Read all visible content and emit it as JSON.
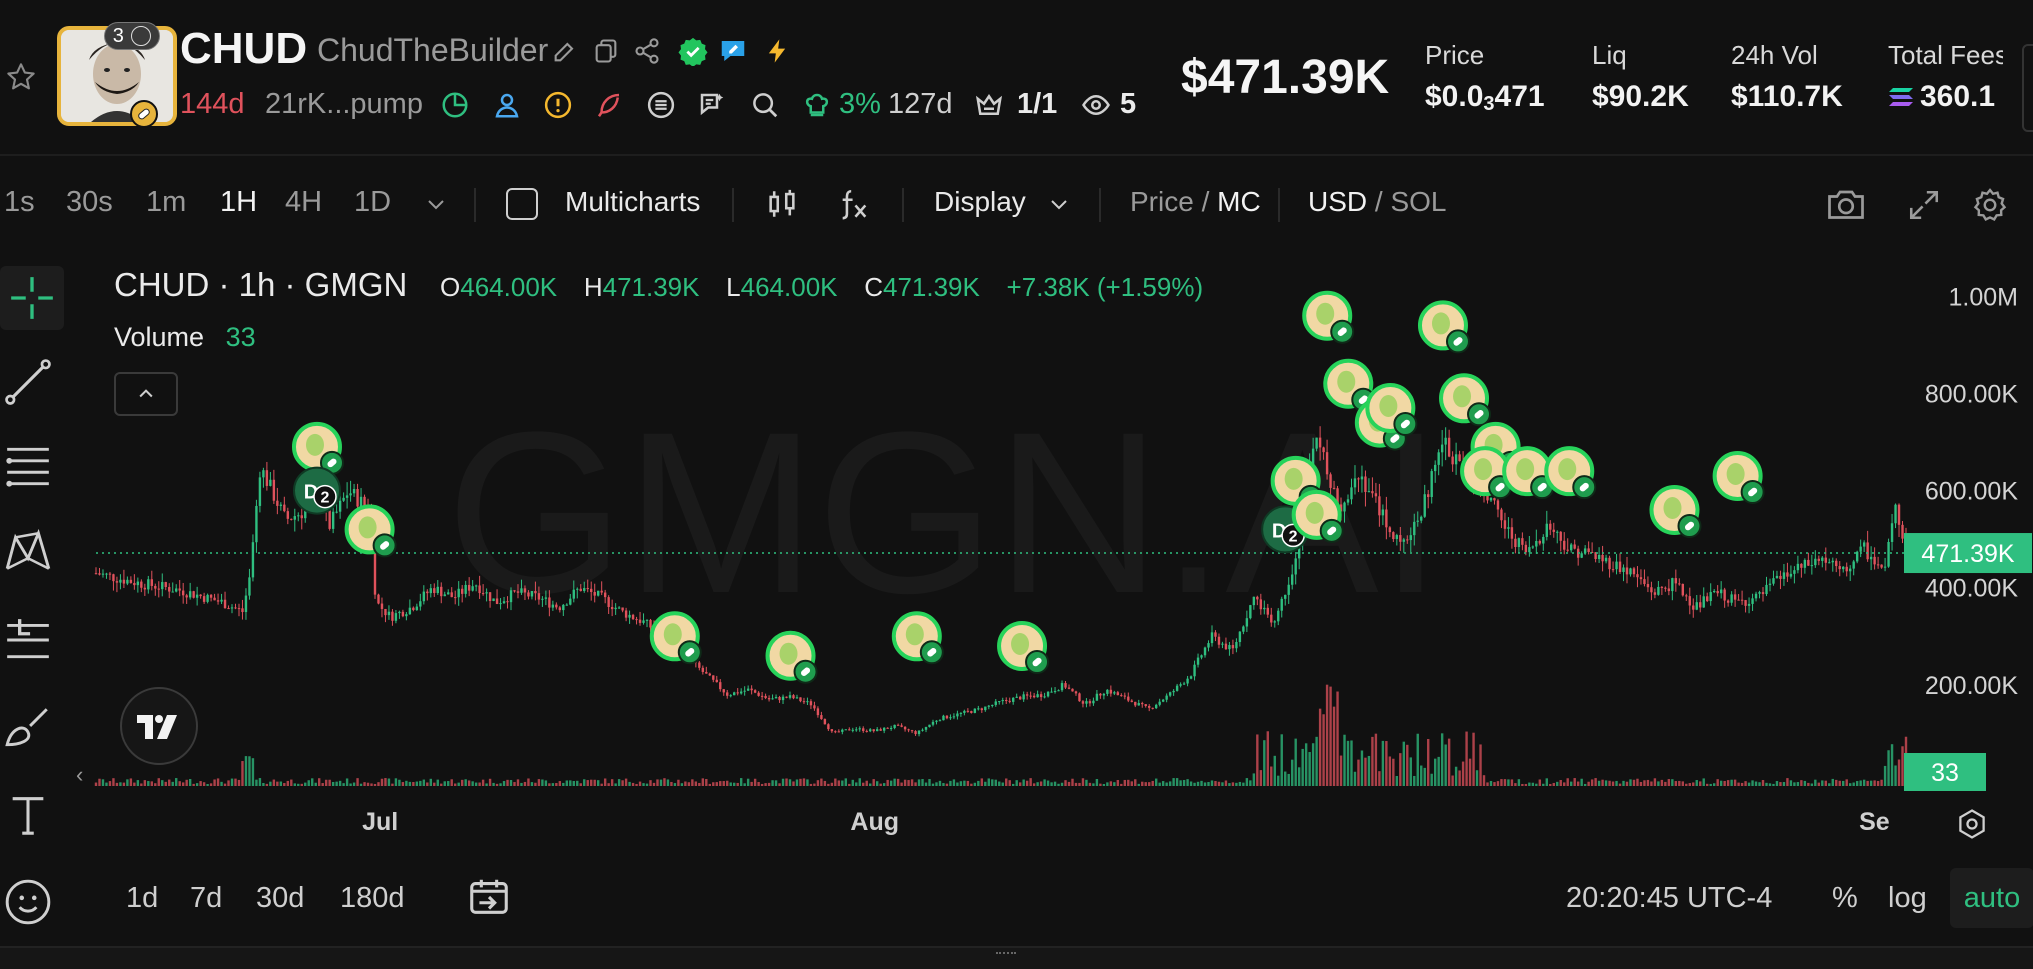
{
  "token": {
    "symbol": "CHUD",
    "creator": "ChudTheBuilder",
    "avatar_badge_count": "3",
    "age": "144d",
    "contract": "21rK...pump",
    "holder_pct": "3%",
    "holder_age": "127d",
    "top_ratio": "1/1",
    "watchers": "5"
  },
  "market_cap": "$471.39K",
  "stats": [
    {
      "label": "Price",
      "value_main": "$0.0",
      "value_sub": "3",
      "value_tail": "471"
    },
    {
      "label": "Liq",
      "value": "$90.2K"
    },
    {
      "label": "24h Vol",
      "value": "$110.7K"
    },
    {
      "label": "Total Fees",
      "value": "360.1"
    }
  ],
  "toolbar": {
    "timeframes": [
      "1s",
      "30s",
      "1m",
      "1H",
      "4H",
      "1D"
    ],
    "active_timeframe": "1H",
    "multicharts": "Multicharts",
    "display": "Display",
    "price_label": "Price",
    "mc_label": "MC",
    "usd_label": "USD",
    "sol_label": "SOL"
  },
  "legend": {
    "title": "CHUD · 1h · GMGN",
    "o_label": "O",
    "o_val": "464.00K",
    "h_label": "H",
    "h_val": "471.39K",
    "l_label": "L",
    "l_val": "464.00K",
    "c_label": "C",
    "c_val": "471.39K",
    "change": "+7.38K (+1.59%)",
    "volume_label": "Volume",
    "volume_val": "33"
  },
  "watermark": "GMGN.AI",
  "chart_data": {
    "type": "line",
    "title": "CHUD · 1h · GMGN",
    "x_ticks": [
      "Jul",
      "Aug",
      "Se"
    ],
    "y_ticks": [
      "1.00M",
      "800.00K",
      "600.00K",
      "400.00K",
      "200.00K"
    ],
    "ylim": [
      0,
      1050000
    ],
    "current_price_label": "471.39K",
    "current_price": 471390,
    "volume_label": "33",
    "price_series": [
      {
        "t": 0,
        "v": 430000
      },
      {
        "t": 2,
        "v": 410000
      },
      {
        "t": 4,
        "v": 395000
      },
      {
        "t": 6,
        "v": 370000
      },
      {
        "t": 7,
        "v": 350000
      },
      {
        "t": 7.3,
        "v": 420000
      },
      {
        "t": 7.8,
        "v": 650000
      },
      {
        "t": 9,
        "v": 540000
      },
      {
        "t": 10,
        "v": 560000
      },
      {
        "t": 10.5,
        "v": 720000
      },
      {
        "t": 11,
        "v": 520000
      },
      {
        "t": 12,
        "v": 600000
      },
      {
        "t": 13,
        "v": 560000
      },
      {
        "t": 13.3,
        "v": 370000
      },
      {
        "t": 14,
        "v": 340000
      },
      {
        "t": 15,
        "v": 360000
      },
      {
        "t": 16,
        "v": 400000
      },
      {
        "t": 17,
        "v": 380000
      },
      {
        "t": 18,
        "v": 410000
      },
      {
        "t": 19,
        "v": 370000
      },
      {
        "t": 20,
        "v": 390000
      },
      {
        "t": 21,
        "v": 380000
      },
      {
        "t": 22,
        "v": 360000
      },
      {
        "t": 23,
        "v": 400000
      },
      {
        "t": 24,
        "v": 380000
      },
      {
        "t": 25,
        "v": 350000
      },
      {
        "t": 26,
        "v": 330000
      },
      {
        "t": 27,
        "v": 300000
      },
      {
        "t": 28,
        "v": 260000
      },
      {
        "t": 29,
        "v": 220000
      },
      {
        "t": 30,
        "v": 180000
      },
      {
        "t": 31,
        "v": 190000
      },
      {
        "t": 32,
        "v": 170000
      },
      {
        "t": 33,
        "v": 175000
      },
      {
        "t": 34,
        "v": 160000
      },
      {
        "t": 35,
        "v": 100000
      },
      {
        "t": 36,
        "v": 110000
      },
      {
        "t": 37,
        "v": 105000
      },
      {
        "t": 38,
        "v": 115000
      },
      {
        "t": 39,
        "v": 100000
      },
      {
        "t": 40,
        "v": 130000
      },
      {
        "t": 41,
        "v": 140000
      },
      {
        "t": 42,
        "v": 150000
      },
      {
        "t": 43,
        "v": 165000
      },
      {
        "t": 44,
        "v": 175000
      },
      {
        "t": 45,
        "v": 180000
      },
      {
        "t": 46,
        "v": 200000
      },
      {
        "t": 47,
        "v": 160000
      },
      {
        "t": 48,
        "v": 190000
      },
      {
        "t": 49,
        "v": 170000
      },
      {
        "t": 50,
        "v": 150000
      },
      {
        "t": 51,
        "v": 180000
      },
      {
        "t": 52,
        "v": 220000
      },
      {
        "t": 53,
        "v": 300000
      },
      {
        "t": 54,
        "v": 270000
      },
      {
        "t": 55,
        "v": 380000
      },
      {
        "t": 56,
        "v": 330000
      },
      {
        "t": 57,
        "v": 460000
      },
      {
        "t": 58,
        "v": 720000
      },
      {
        "t": 59,
        "v": 560000
      },
      {
        "t": 60,
        "v": 640000
      },
      {
        "t": 61,
        "v": 560000
      },
      {
        "t": 62,
        "v": 480000
      },
      {
        "t": 63,
        "v": 560000
      },
      {
        "t": 64,
        "v": 700000
      },
      {
        "t": 65,
        "v": 640000
      },
      {
        "t": 66,
        "v": 600000
      },
      {
        "t": 67,
        "v": 520000
      },
      {
        "t": 68,
        "v": 470000
      },
      {
        "t": 69,
        "v": 530000
      },
      {
        "t": 70,
        "v": 480000
      },
      {
        "t": 71,
        "v": 470000
      },
      {
        "t": 72,
        "v": 450000
      },
      {
        "t": 73,
        "v": 430000
      },
      {
        "t": 74,
        "v": 390000
      },
      {
        "t": 75,
        "v": 410000
      },
      {
        "t": 76,
        "v": 360000
      },
      {
        "t": 77,
        "v": 390000
      },
      {
        "t": 78,
        "v": 370000
      },
      {
        "t": 79,
        "v": 380000
      },
      {
        "t": 80,
        "v": 420000
      },
      {
        "t": 81,
        "v": 440000
      },
      {
        "t": 82,
        "v": 460000
      },
      {
        "t": 83,
        "v": 430000
      },
      {
        "t": 84,
        "v": 480000
      },
      {
        "t": 85,
        "v": 430000
      },
      {
        "t": 85.5,
        "v": 580000
      },
      {
        "t": 86,
        "v": 471390
      }
    ]
  },
  "markers": [
    {
      "type": "coin",
      "t": 10.5,
      "v": 690000
    },
    {
      "type": "dev",
      "t": 10.5,
      "v": 600000,
      "count": "2"
    },
    {
      "type": "coin",
      "t": 13,
      "v": 520000
    },
    {
      "type": "coin",
      "t": 27.5,
      "v": 300000
    },
    {
      "type": "coin",
      "t": 33,
      "v": 260000
    },
    {
      "type": "coin",
      "t": 39,
      "v": 300000
    },
    {
      "type": "coin",
      "t": 44,
      "v": 280000
    },
    {
      "type": "dev",
      "t": 56.5,
      "v": 520000,
      "count": "2"
    },
    {
      "type": "coin",
      "t": 57,
      "v": 620000
    },
    {
      "type": "coin",
      "t": 58,
      "v": 550000
    },
    {
      "type": "coin",
      "t": 58.5,
      "v": 960000
    },
    {
      "type": "coin",
      "t": 59.5,
      "v": 820000
    },
    {
      "type": "coin",
      "t": 61,
      "v": 740000
    },
    {
      "type": "coin",
      "t": 61.5,
      "v": 770000
    },
    {
      "type": "coin",
      "t": 64,
      "v": 940000
    },
    {
      "type": "coin",
      "t": 65,
      "v": 790000
    },
    {
      "type": "coin",
      "t": 66.5,
      "v": 690000
    },
    {
      "type": "coin",
      "t": 66,
      "v": 640000
    },
    {
      "type": "coin",
      "t": 68,
      "v": 640000
    },
    {
      "type": "coin",
      "t": 70,
      "v": 640000
    },
    {
      "type": "coin",
      "t": 75,
      "v": 560000
    },
    {
      "type": "coin",
      "t": 78,
      "v": 630000
    }
  ],
  "bottom": {
    "periods": [
      "1d",
      "7d",
      "30d",
      "180d"
    ],
    "time": "20:20:45 UTC-4",
    "pct": "%",
    "log": "log",
    "auto": "auto"
  },
  "colors": {
    "up": "#2fbf80",
    "down": "#e0525c",
    "accent": "#2fbf80",
    "bg": "#111111"
  }
}
